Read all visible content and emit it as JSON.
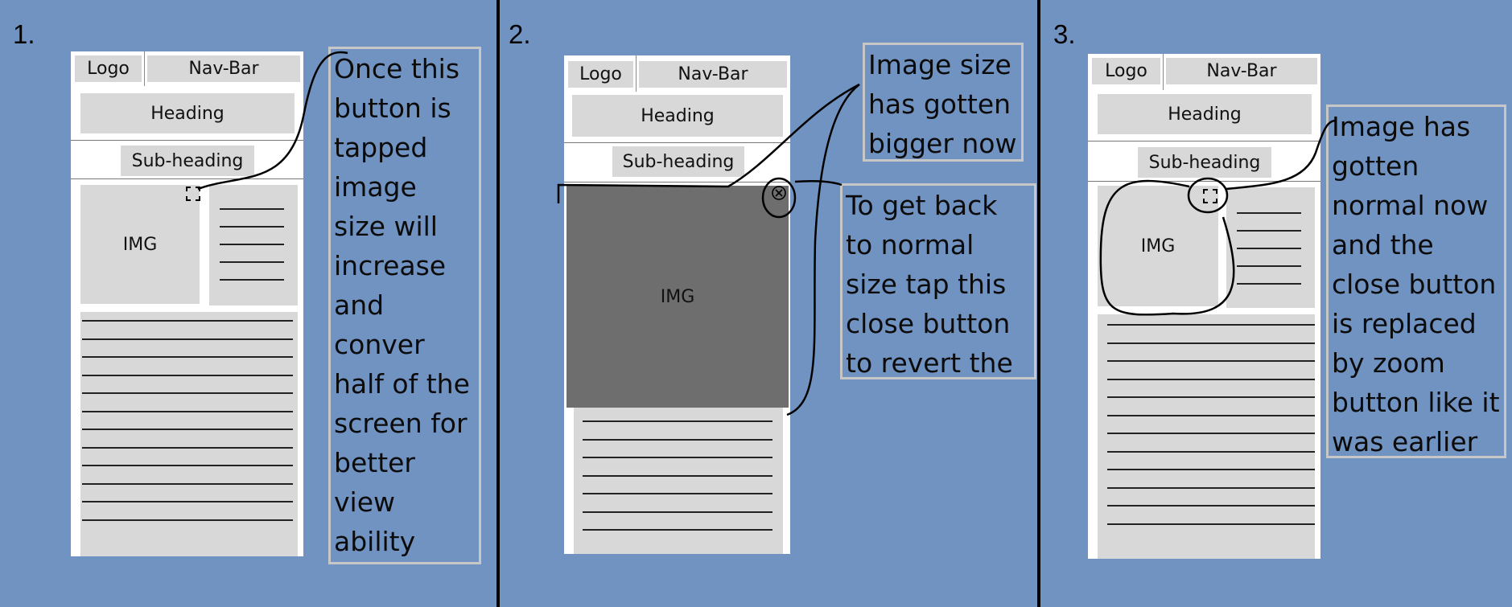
{
  "panels": [
    {
      "step": "1.",
      "logo": "Logo",
      "nav": "Nav-Bar",
      "heading": "Heading",
      "subheading": "Sub-heading",
      "img": "IMG",
      "icon": "expand-icon",
      "callout": "Once this button is tapped image size will increase and conver half of the screen for better view ability"
    },
    {
      "step": "2.",
      "logo": "Logo",
      "nav": "Nav-Bar",
      "heading": "Heading",
      "subheading": "Sub-heading",
      "img": "IMG",
      "icon": "close-circle-icon",
      "callout_top": "Image size has gotten bigger now",
      "callout_side": "To get back to normal size tap this close button to revert the size"
    },
    {
      "step": "3.",
      "logo": "Logo",
      "nav": "Nav-Bar",
      "heading": "Heading",
      "subheading": "Sub-heading",
      "img": "IMG",
      "icon": "expand-icon",
      "callout": "Image has gotten normal now and the close button is replaced by zoom button like it was earlier"
    }
  ],
  "colors": {
    "background": "#7193c2",
    "block": "#d8d8d8",
    "expanded_image": "#6e6e6e",
    "callout_border": "#c7c7c7"
  }
}
